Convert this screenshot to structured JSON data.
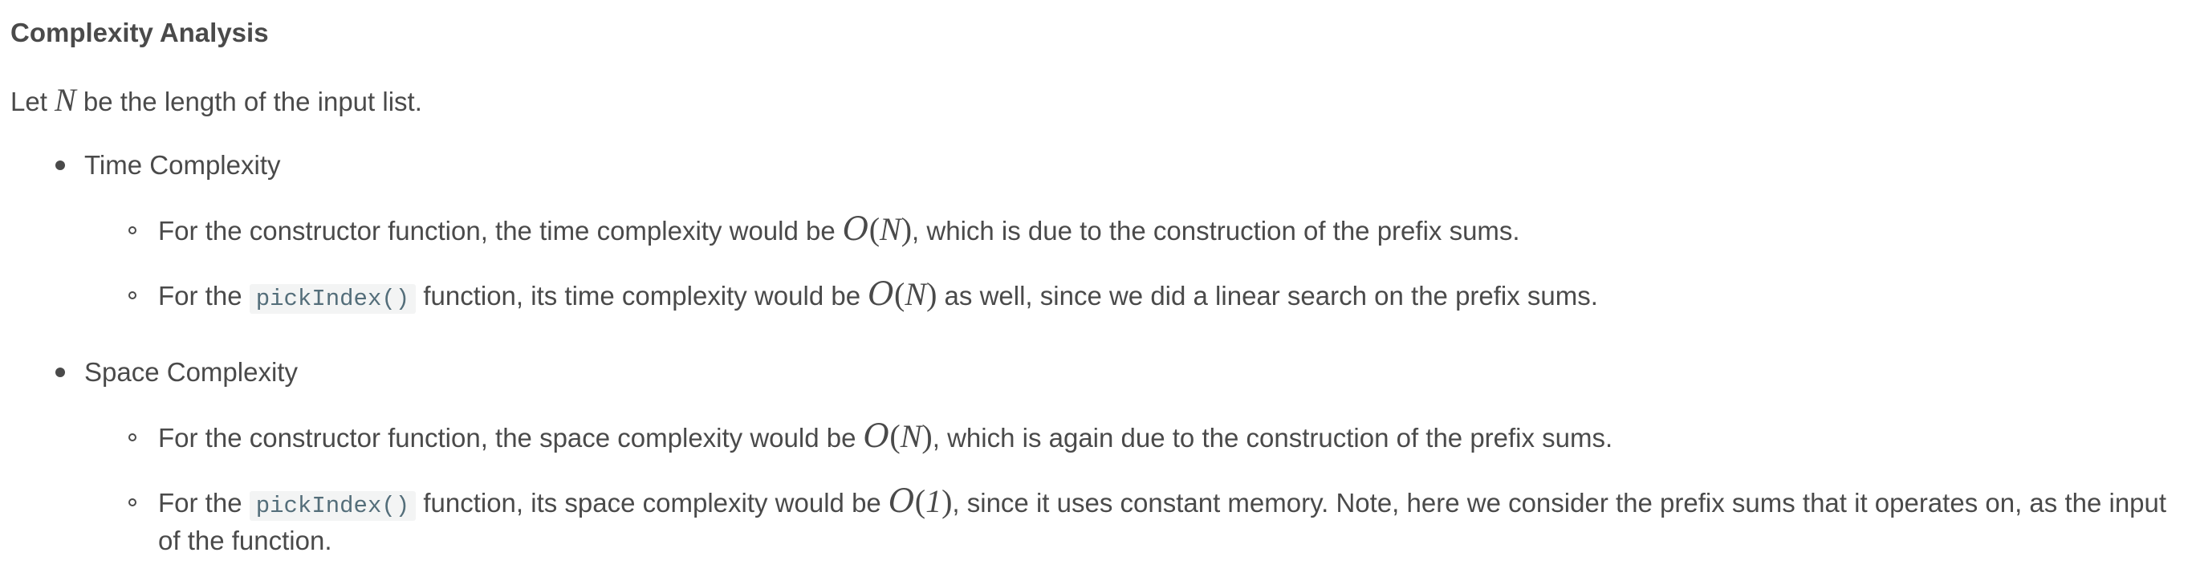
{
  "heading": "Complexity Analysis",
  "intro": {
    "prefix": "Let ",
    "var": "N",
    "suffix": " be the length of the input list."
  },
  "sections": [
    {
      "title": "Time Complexity",
      "items": [
        {
          "a": "For the constructor function, the time complexity would be ",
          "math_o": "O",
          "math_arg": "N",
          "b": ", which is due to the construction of the prefix sums."
        },
        {
          "a": "For the ",
          "code": "pickIndex()",
          "b": " function, its time complexity would be ",
          "math_o": "O",
          "math_arg": "N",
          "c": " as well, since we did a linear search on the prefix sums."
        }
      ]
    },
    {
      "title": "Space Complexity",
      "items": [
        {
          "a": "For the constructor function, the space complexity would be ",
          "math_o": "O",
          "math_arg": "N",
          "b": ", which is again due to the construction of the prefix sums."
        },
        {
          "a": "For the ",
          "code": "pickIndex()",
          "b": " function, its space complexity would be ",
          "math_o": "O",
          "math_arg": "1",
          "c": ", since it uses constant memory. Note, here we consider the prefix sums that it operates on, as the input",
          "d": "of the function."
        }
      ]
    }
  ]
}
